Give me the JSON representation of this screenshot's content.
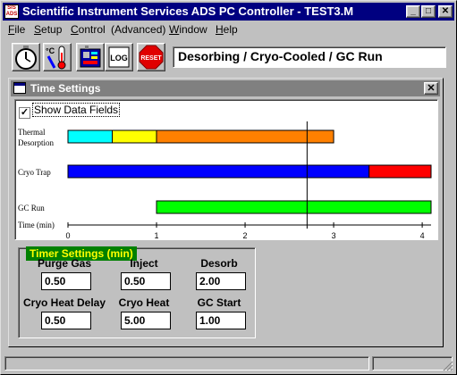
{
  "window": {
    "title": "Scientific Instrument Services ADS PC Controller - TEST3.M",
    "icon_text": "SIS ADS",
    "minimize_glyph": "_",
    "maximize_glyph": "□",
    "close_glyph": "✕"
  },
  "menu": [
    {
      "label": "File",
      "accel": "F"
    },
    {
      "label": "Setup",
      "accel": "S"
    },
    {
      "label": "Control",
      "accel": "C"
    },
    {
      "label": "(Advanced)",
      "accel": ""
    },
    {
      "label": "Window",
      "accel": "W"
    },
    {
      "label": "Help",
      "accel": "H"
    }
  ],
  "toolbar": {
    "buttons": [
      {
        "name": "timer-button",
        "icon": "stopwatch-icon"
      },
      {
        "name": "temperature-button",
        "icon": "thermometer-icon"
      },
      {
        "name": "method-button",
        "icon": "instrument-icon"
      },
      {
        "name": "log-button",
        "icon": "log-icon",
        "label": "LOG"
      },
      {
        "name": "reset-button",
        "icon": "stop-sign-icon",
        "label": "RESET"
      }
    ],
    "status": "Desorbing / Cryo-Cooled / GC Run"
  },
  "child_window": {
    "title": "Time Settings",
    "close_glyph": "✕"
  },
  "show_data_fields": {
    "label": "Show Data Fields",
    "checked": true,
    "check_glyph": "✓"
  },
  "chart_data": {
    "type": "gantt",
    "xlabel": "Time (min)",
    "xlim": [
      0,
      4.1
    ],
    "ticks": [
      "0",
      "1",
      "2",
      "3",
      "4"
    ],
    "current_time": 2.7,
    "rows": [
      {
        "label_lines": [
          "Thermal",
          "Desorption"
        ],
        "segments": [
          {
            "start": 0,
            "end": 0.5,
            "color": "#00ffff"
          },
          {
            "start": 0.5,
            "end": 1.0,
            "color": "#ffff00"
          },
          {
            "start": 1.0,
            "end": 3.0,
            "color": "#ff8000"
          }
        ]
      },
      {
        "label_lines": [
          "Cryo Trap"
        ],
        "segments": [
          {
            "start": 0,
            "end": 3.4,
            "color": "#0000ff"
          },
          {
            "start": 3.4,
            "end": 4.1,
            "color": "#ff0000"
          }
        ]
      },
      {
        "label_lines": [
          "GC Run"
        ],
        "segments": [
          {
            "start": 1.0,
            "end": 4.1,
            "color": "#00ff00"
          }
        ]
      }
    ]
  },
  "timer_settings": {
    "title": "Timer Settings (min)",
    "fields": [
      {
        "label": "Purge Gas",
        "value": "0.50"
      },
      {
        "label": "Inject",
        "value": "0.50"
      },
      {
        "label": "Desorb",
        "value": "2.00"
      },
      {
        "label": "Cryo Heat Delay",
        "value": "0.50"
      },
      {
        "label": "Cryo Heat",
        "value": "5.00"
      },
      {
        "label": "GC Start",
        "value": "1.00"
      }
    ]
  },
  "colors": {
    "active_title": "#000080",
    "inactive_title": "#808080",
    "face": "#c0c0c0",
    "legend_bg": "#008000",
    "legend_text": "#ffff00"
  }
}
